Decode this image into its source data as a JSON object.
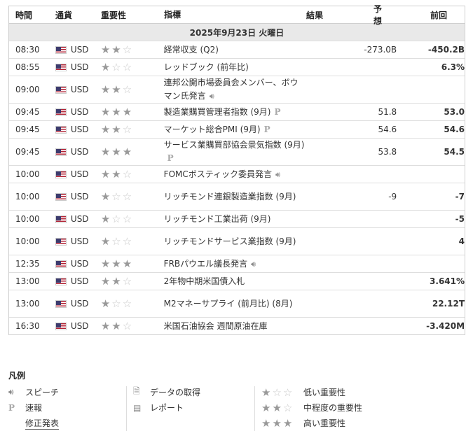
{
  "header": {
    "time": "時間",
    "currency": "通貨",
    "importance": "重要性",
    "event": "指標",
    "actual": "結果",
    "forecast": "予想",
    "previous": "前回"
  },
  "date_label": "2025年9月23日 火曜日",
  "rows": [
    {
      "time": "08:30",
      "currency": "USD",
      "importance": 2,
      "event": "経常収支 (Q2)",
      "icon": "",
      "actual": "",
      "forecast": "-273.0B",
      "previous": "-450.2B"
    },
    {
      "time": "08:55",
      "currency": "USD",
      "importance": 1,
      "event": "レッドブック (前年比)",
      "icon": "",
      "actual": "",
      "forecast": "",
      "previous": "6.3%"
    },
    {
      "time": "09:00",
      "currency": "USD",
      "importance": 2,
      "event": "連邦公開市場委員会メンバー、ボウマン氏発言",
      "icon": "speaker-icon",
      "actual": "",
      "forecast": "",
      "previous": ""
    },
    {
      "time": "09:45",
      "currency": "USD",
      "importance": 3,
      "event": "製造業購買管理者指数 (9月)",
      "icon": "preliminary-icon",
      "actual": "",
      "forecast": "51.8",
      "previous": "53.0"
    },
    {
      "time": "09:45",
      "currency": "USD",
      "importance": 2,
      "event": "マーケット総合PMI (9月)",
      "icon": "preliminary-icon",
      "actual": "",
      "forecast": "54.6",
      "previous": "54.6"
    },
    {
      "time": "09:45",
      "currency": "USD",
      "importance": 3,
      "event": "サービス業購買部協会景気指数 (9月)",
      "icon": "preliminary-icon",
      "actual": "",
      "forecast": "53.8",
      "previous": "54.5"
    },
    {
      "time": "10:00",
      "currency": "USD",
      "importance": 2,
      "event": "FOMCボスティック委員発言",
      "icon": "speaker-icon",
      "actual": "",
      "forecast": "",
      "previous": ""
    },
    {
      "time": "10:00",
      "currency": "USD",
      "importance": 1,
      "event": "リッチモンド連銀製造業指数 (9月)",
      "icon": "",
      "actual": "",
      "forecast": "-9",
      "previous": "-7"
    },
    {
      "time": "10:00",
      "currency": "USD",
      "importance": 1,
      "event": "リッチモンド工業出荷 (9月)",
      "icon": "",
      "actual": "",
      "forecast": "",
      "previous": "-5"
    },
    {
      "time": "10:00",
      "currency": "USD",
      "importance": 1,
      "event": "リッチモンドサービス業指数 (9月)",
      "icon": "",
      "actual": "",
      "forecast": "",
      "previous": "4"
    },
    {
      "time": "12:35",
      "currency": "USD",
      "importance": 3,
      "event": "FRBパウエル議長発言",
      "icon": "speaker-icon",
      "actual": "",
      "forecast": "",
      "previous": ""
    },
    {
      "time": "13:00",
      "currency": "USD",
      "importance": 2,
      "event": "2年物中期米国債入札",
      "icon": "",
      "actual": "",
      "forecast": "",
      "previous": "3.641%"
    },
    {
      "time": "13:00",
      "currency": "USD",
      "importance": 1,
      "event": "M2マネーサプライ (前月比) (8月)",
      "icon": "",
      "actual": "",
      "forecast": "",
      "previous": "22.12T"
    },
    {
      "time": "16:30",
      "currency": "USD",
      "importance": 2,
      "event": "米国石油協会 週間原油在庫",
      "icon": "",
      "actual": "",
      "forecast": "",
      "previous": "-3.420M"
    }
  ],
  "legend": {
    "title": "凡例",
    "speech": "スピーチ",
    "preliminary": "速報",
    "revised": "修正発表",
    "data_fetch": "データの取得",
    "report": "レポート",
    "low": "低い重要性",
    "medium": "中程度の重要性",
    "high": "高い重要性"
  }
}
